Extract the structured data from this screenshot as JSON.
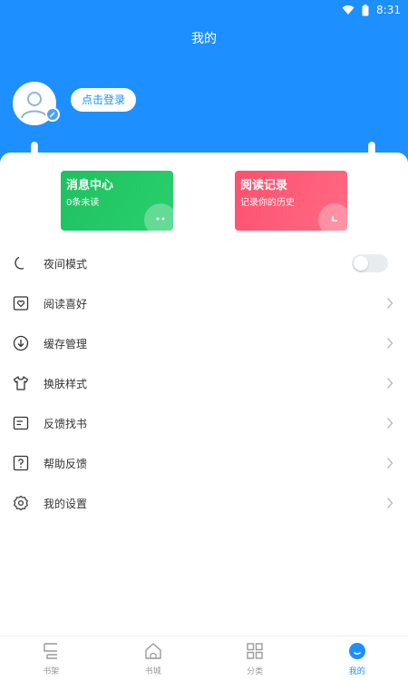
{
  "status_bar": {
    "time": "8:31"
  },
  "header": {
    "title": "我的",
    "login_label": "点击登录"
  },
  "cards": {
    "messages": {
      "title": "消息中心",
      "subtitle": "0条未读"
    },
    "history": {
      "title": "阅读记录",
      "subtitle": "记录你的历史"
    }
  },
  "menu": {
    "items": [
      {
        "label": "夜间模式",
        "icon": "moon-icon",
        "control": "toggle",
        "toggle_on": false
      },
      {
        "label": "阅读喜好",
        "icon": "heart-book-icon",
        "control": "chevron"
      },
      {
        "label": "缓存管理",
        "icon": "download-icon",
        "control": "chevron"
      },
      {
        "label": "换肤样式",
        "icon": "shirt-icon",
        "control": "chevron"
      },
      {
        "label": "反馈找书",
        "icon": "feedback-icon",
        "control": "chevron"
      },
      {
        "label": "帮助反馈",
        "icon": "help-icon",
        "control": "chevron"
      },
      {
        "label": "我的设置",
        "icon": "gear-icon",
        "control": "chevron"
      }
    ]
  },
  "tabbar": {
    "tabs": [
      {
        "label": "书架",
        "icon": "bookshelf-icon"
      },
      {
        "label": "书城",
        "icon": "home-icon"
      },
      {
        "label": "分类",
        "icon": "grid-icon"
      },
      {
        "label": "我的",
        "icon": "profile-icon",
        "active": true
      }
    ]
  },
  "colors": {
    "primary": "#1e8fff",
    "card_green": "#1ec15f",
    "card_red": "#ff4f6e",
    "toggle_off": "#e9ecef"
  }
}
